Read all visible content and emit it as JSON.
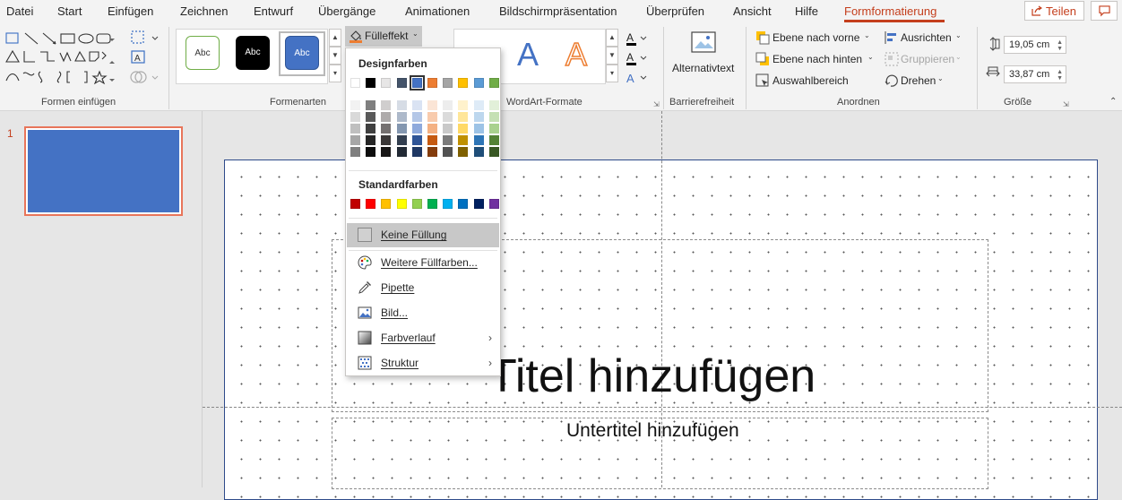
{
  "menu_tabs": [
    "Datei",
    "Start",
    "Einfügen",
    "Zeichnen",
    "Entwurf",
    "Übergänge",
    "Animationen",
    "Bildschirmpräsentation",
    "Überprüfen",
    "Ansicht",
    "Hilfe",
    "Formformatierung"
  ],
  "active_tab": "Formformatierung",
  "share_label": "Teilen",
  "groups": {
    "insert_shapes": "Formen einfügen",
    "shape_styles": "Formenarten",
    "wordart": "WordArt-Formate",
    "accessibility": "Barrierefreiheit",
    "arrange": "Anordnen",
    "size": "Größe"
  },
  "style_buttons": [
    "Abc",
    "Abc",
    "Abc"
  ],
  "fill_button": "Fülleffekt",
  "alt_text": "Alternativtext",
  "wordart_letters": [
    "A",
    "A"
  ],
  "arrange": {
    "bring_forward": "Ebene nach vorne",
    "send_backward": "Ebene nach hinten",
    "selection_pane": "Auswahlbereich",
    "align": "Ausrichten",
    "group": "Gruppieren",
    "rotate": "Drehen"
  },
  "size": {
    "height": "19,05 cm",
    "width": "33,87 cm"
  },
  "slide_number": "1",
  "slide": {
    "title": "Titel hinzufügen",
    "subtitle": "Untertitel hinzufügen"
  },
  "colors": {
    "accent": "#c43e1c",
    "shape_fill": "#4472c4"
  },
  "dropdown": {
    "design_colors_label": "Designfarben",
    "design_colors": [
      "#ffffff",
      "#000000",
      "#e7e6e6",
      "#44546a",
      "#4472c4",
      "#ed7d31",
      "#a5a5a5",
      "#ffc000",
      "#5b9bd5",
      "#70ad47"
    ],
    "shades": [
      [
        "#f2f2f2",
        "#d9d9d9",
        "#bfbfbf",
        "#a6a6a6",
        "#7f7f7f"
      ],
      [
        "#7f7f7f",
        "#595959",
        "#404040",
        "#262626",
        "#0d0d0d"
      ],
      [
        "#d0cece",
        "#aeabab",
        "#757171",
        "#3b3838",
        "#171616"
      ],
      [
        "#d6dce5",
        "#adb9ca",
        "#8497b0",
        "#333f50",
        "#222a35"
      ],
      [
        "#dae3f3",
        "#b4c7e7",
        "#8faadc",
        "#2f5597",
        "#1f3864"
      ],
      [
        "#fbe5d6",
        "#f8cbad",
        "#f4b183",
        "#c55a11",
        "#843c0c"
      ],
      [
        "#ededed",
        "#dbdbdb",
        "#c9c9c9",
        "#7b7b7b",
        "#525252"
      ],
      [
        "#fff2cc",
        "#ffe699",
        "#ffd966",
        "#bf9000",
        "#7f6000"
      ],
      [
        "#deebf7",
        "#bdd7ee",
        "#9dc3e6",
        "#2e75b6",
        "#1f4e79"
      ],
      [
        "#e2f0d9",
        "#c5e0b4",
        "#a9d18e",
        "#548235",
        "#385723"
      ]
    ],
    "standard_colors_label": "Standardfarben",
    "standard_colors": [
      "#c00000",
      "#ff0000",
      "#ffc000",
      "#ffff00",
      "#92d050",
      "#00b050",
      "#00b0f0",
      "#0070c0",
      "#002060",
      "#7030a0"
    ],
    "items": {
      "no_fill": "Keine Füllung",
      "more_colors": "Weitere Füllfarben...",
      "eyedropper": "Pipette",
      "picture": "Bild...",
      "gradient": "Farbverlauf",
      "texture": "Struktur"
    }
  }
}
